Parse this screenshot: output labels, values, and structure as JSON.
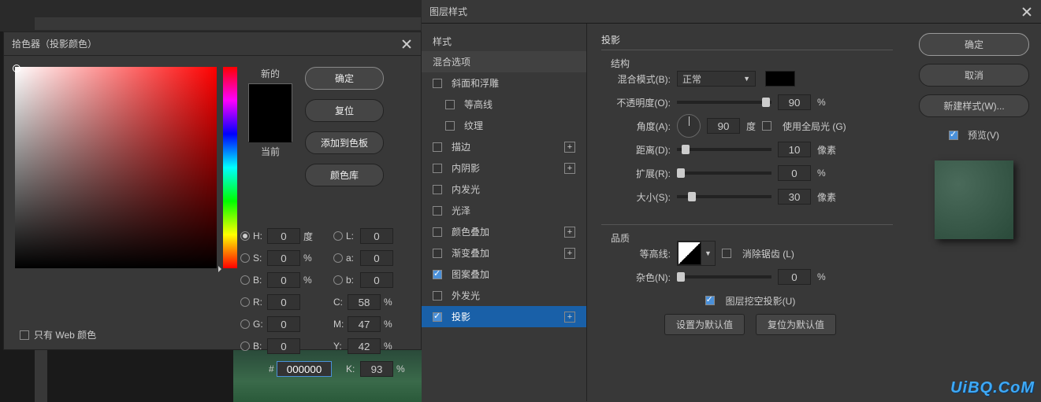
{
  "colorPicker": {
    "title": "拾色器（投影颜色）",
    "newLabel": "新的",
    "currentLabel": "当前",
    "buttons": {
      "ok": "确定",
      "reset": "复位",
      "addSwatch": "添加到色板",
      "colorLib": "颜色库"
    },
    "hsb": {
      "H": {
        "label": "H:",
        "val": "0",
        "unit": "度"
      },
      "S": {
        "label": "S:",
        "val": "0",
        "unit": "%"
      },
      "B": {
        "label": "B:",
        "val": "0",
        "unit": "%"
      }
    },
    "rgb": {
      "R": {
        "label": "R:",
        "val": "0"
      },
      "G": {
        "label": "G:",
        "val": "0"
      },
      "B": {
        "label": "B:",
        "val": "0"
      }
    },
    "lab": {
      "L": {
        "label": "L:",
        "val": "0"
      },
      "a": {
        "label": "a:",
        "val": "0"
      },
      "b": {
        "label": "b:",
        "val": "0"
      }
    },
    "cmyk": {
      "C": {
        "label": "C:",
        "val": "58",
        "unit": "%"
      },
      "M": {
        "label": "M:",
        "val": "47",
        "unit": "%"
      },
      "Y": {
        "label": "Y:",
        "val": "42",
        "unit": "%"
      },
      "K": {
        "label": "K:",
        "val": "93",
        "unit": "%"
      }
    },
    "hexPrefix": "#",
    "hex": "000000",
    "webOnly": "只有 Web 颜色"
  },
  "layerStyle": {
    "title": "图层样式",
    "stylesHeader": "样式",
    "items": {
      "blending": "混合选项",
      "bevel": "斜面和浮雕",
      "contour": "等高线",
      "texture": "纹理",
      "stroke": "描边",
      "innerShadow": "内阴影",
      "innerGlow": "内发光",
      "satin": "光泽",
      "colorOverlay": "颜色叠加",
      "gradientOverlay": "渐变叠加",
      "patternOverlay": "图案叠加",
      "outerGlow": "外发光",
      "dropShadow": "投影"
    },
    "panel": {
      "title": "投影",
      "structure": "结构",
      "blendModeLbl": "混合模式(B):",
      "blendMode": "正常",
      "opacityLbl": "不透明度(O):",
      "opacity": "90",
      "opacityUnit": "%",
      "angleLbl": "角度(A):",
      "angle": "90",
      "angleUnit": "度",
      "globalLight": "使用全局光 (G)",
      "distanceLbl": "距离(D):",
      "distance": "10",
      "distanceUnit": "像素",
      "spreadLbl": "扩展(R):",
      "spread": "0",
      "spreadUnit": "%",
      "sizeLbl": "大小(S):",
      "size": "30",
      "sizeUnit": "像素",
      "quality": "品质",
      "contourLbl": "等高线:",
      "antiAlias": "消除锯齿 (L)",
      "noiseLbl": "杂色(N):",
      "noise": "0",
      "noiseUnit": "%",
      "knockout": "图层挖空投影(U)",
      "makeDefault": "设置为默认值",
      "resetDefault": "复位为默认值"
    },
    "right": {
      "ok": "确定",
      "cancel": "取消",
      "newStyle": "新建样式(W)...",
      "preview": "预览(V)"
    }
  },
  "watermark": "UiBQ.CoM"
}
